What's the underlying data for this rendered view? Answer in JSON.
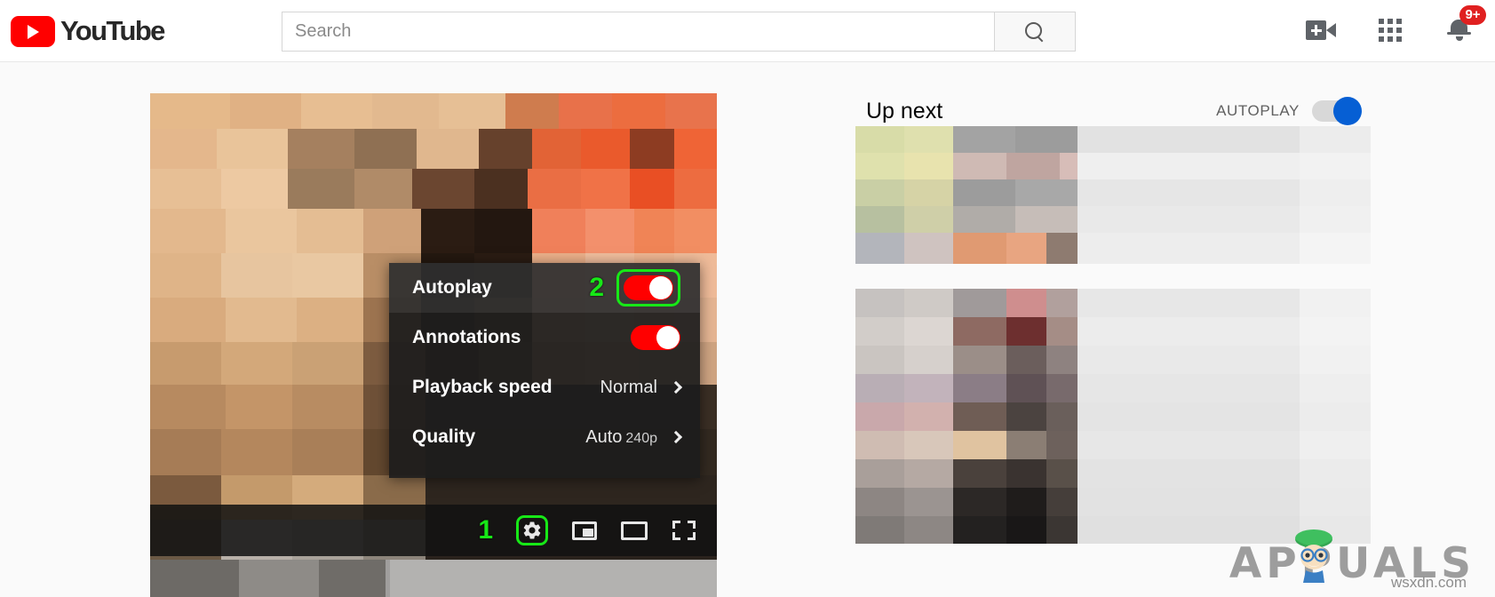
{
  "header": {
    "logo_text": "YouTube",
    "logo_icon": "youtube-play-icon",
    "search": {
      "placeholder": "Search",
      "value": "",
      "button_icon": "search-icon"
    },
    "icons": [
      {
        "name": "create-video-icon",
        "label": "Create"
      },
      {
        "name": "apps-grid-icon",
        "label": "YouTube apps"
      },
      {
        "name": "notifications-bell-icon",
        "label": "Notifications"
      }
    ],
    "notification_badge": "9+"
  },
  "player": {
    "controls": [
      {
        "name": "settings-gear-icon",
        "label": "Settings",
        "callout": "1",
        "highlighted": true
      },
      {
        "name": "miniplayer-icon",
        "label": "Miniplayer",
        "highlighted": false
      },
      {
        "name": "theater-mode-icon",
        "label": "Theater mode",
        "highlighted": false
      },
      {
        "name": "fullscreen-icon",
        "label": "Full screen",
        "highlighted": false
      }
    ]
  },
  "settings_menu": {
    "rows": [
      {
        "label": "Autoplay",
        "type": "toggle",
        "state": "on",
        "callout": "2",
        "highlighted": true
      },
      {
        "label": "Annotations",
        "type": "toggle",
        "state": "on",
        "callout": "",
        "highlighted": false
      },
      {
        "label": "Playback speed",
        "type": "submenu",
        "value": "Normal",
        "value_sub": "",
        "highlighted": false
      },
      {
        "label": "Quality",
        "type": "submenu",
        "value": "Auto",
        "value_sub": "240p",
        "highlighted": false
      }
    ]
  },
  "sidebar": {
    "title": "Up next",
    "autoplay_label": "AUTOPLAY",
    "autoplay_state": "on"
  },
  "watermark": {
    "brand": "APPUALS",
    "brand_part_a": "A",
    "brand_part_b": "PUALS",
    "url": "wsxdn.com"
  },
  "colors": {
    "youtube_red": "#ff0000",
    "callout_green": "#17e817",
    "autoplay_blue": "#065fd4",
    "badge_red": "#e02020",
    "menu_bg": "#1c1c1c"
  }
}
